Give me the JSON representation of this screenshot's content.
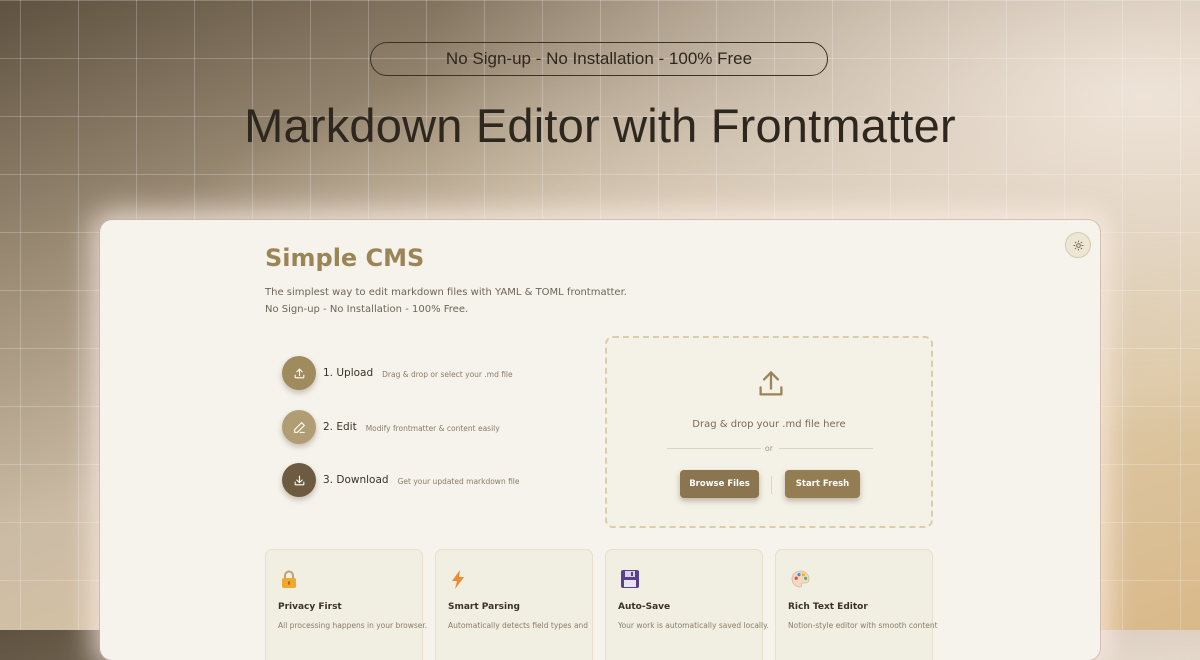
{
  "hero": {
    "pill_text": "No Sign-up - No Installation - 100% Free",
    "headline": "Markdown Editor with Frontmatter"
  },
  "app": {
    "brand": "Simple CMS",
    "tagline_line1": "The simplest way to edit markdown files with YAML & TOML frontmatter.",
    "tagline_line2": "No Sign-up - No Installation - 100% Free.",
    "theme_toggle_icon": "sun-icon",
    "steps": [
      {
        "title": "1. Upload",
        "desc": "Drag & drop or select your .md file",
        "icon": "upload-icon",
        "color": "#a08b5f"
      },
      {
        "title": "2. Edit",
        "desc": "Modify frontmatter & content easily",
        "icon": "pencil-icon",
        "color": "#b09d73"
      },
      {
        "title": "3. Download",
        "desc": "Get your updated markdown file",
        "icon": "download-icon",
        "color": "#6c5b41"
      }
    ],
    "dropzone": {
      "icon": "upload-icon",
      "text": "Drag & drop your .md file here",
      "or": "or",
      "browse_label": "Browse Files",
      "fresh_label": "Start Fresh"
    },
    "features": [
      {
        "title": "Privacy First",
        "desc": "All processing happens in your browser.",
        "icon": "lock-icon"
      },
      {
        "title": "Smart Parsing",
        "desc": "Automatically detects field types and",
        "icon": "lightning-icon"
      },
      {
        "title": "Auto-Save",
        "desc": "Your work is automatically saved locally.",
        "icon": "floppy-disk-icon"
      },
      {
        "title": "Rich Text Editor",
        "desc": "Notion-style editor with smooth content",
        "icon": "palette-icon"
      }
    ],
    "colors": {
      "accent": "#9b8455",
      "button": "#8a7550",
      "background": "#f5f3ec"
    }
  }
}
